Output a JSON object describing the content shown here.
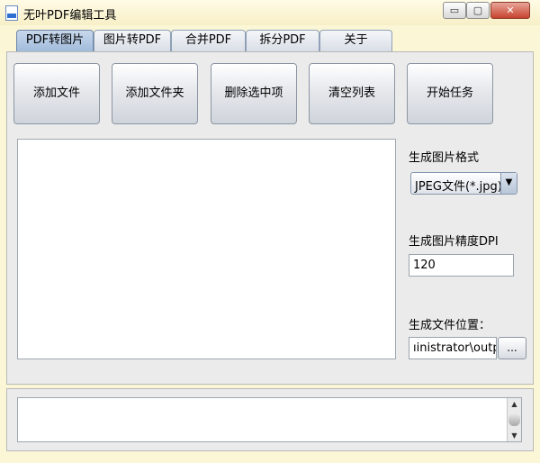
{
  "window": {
    "title": "无叶PDF编辑工具",
    "controls": {
      "minimize": "▭",
      "maximize": "▢",
      "close": "✕"
    }
  },
  "tabs": [
    {
      "label": "PDF转图片",
      "active": true
    },
    {
      "label": "图片转PDF",
      "active": false
    },
    {
      "label": "合并PDF",
      "active": false
    },
    {
      "label": "拆分PDF",
      "active": false
    },
    {
      "label": "关于",
      "active": false
    }
  ],
  "toolbar": {
    "add_file": "添加文件",
    "add_folder": "添加文件夹",
    "delete_selected": "删除选中项",
    "clear_list": "清空列表",
    "start_task": "开始任务"
  },
  "settings": {
    "format_label": "生成图片格式",
    "format_value": "JPEG文件(*.jpg)",
    "dpi_label": "生成图片精度DPI",
    "dpi_value": "120",
    "output_label": "生成文件位置：",
    "output_value": "ıinistrator\\output",
    "browse_label": "..."
  },
  "icons": {
    "app": "pdf-document-icon",
    "dropdown": "▼",
    "scroll_up": "▲",
    "scroll_down": "▼"
  },
  "colors": {
    "window_bg": "#fbf6d6",
    "panel_bg": "#ebebeb",
    "active_tab": "#b2c8e3",
    "close_button": "#c7442e"
  }
}
